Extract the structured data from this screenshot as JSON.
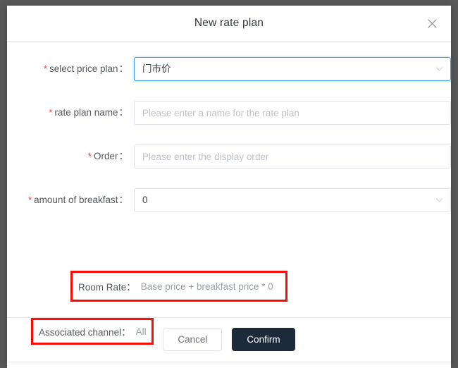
{
  "dialog": {
    "title": "New rate plan",
    "close_icon": "close-icon"
  },
  "form": {
    "fields": [
      {
        "label": "select price plan",
        "required": true,
        "type": "select",
        "value": "门市价",
        "focused": true,
        "chevron_icon": "chevron-down-icon"
      },
      {
        "label": "rate plan name",
        "required": true,
        "type": "text",
        "value": "",
        "placeholder": "Please enter a name for the rate plan"
      },
      {
        "label": "Order",
        "required": true,
        "type": "text",
        "value": "",
        "placeholder": "Please enter the display order"
      },
      {
        "label": "amount of breakfast",
        "required": true,
        "type": "select",
        "value": "0",
        "focused": false,
        "chevron_icon": "chevron-down-icon"
      }
    ],
    "colon": "：",
    "asterisk": "*"
  },
  "summary": {
    "room_rate": {
      "label": "Room Rate：",
      "value": "Base price + breakfast price * 0",
      "highlighted": true
    },
    "associated_channel": {
      "label": "Associated channel：",
      "value": "All",
      "highlighted": true
    }
  },
  "footer": {
    "cancel_label": "Cancel",
    "confirm_label": "Confirm"
  },
  "colors": {
    "highlight_box": "#fb0d06",
    "required_star": "#e8403a",
    "focus_border": "#3aa0f3",
    "confirm_button": "#1d2a3a",
    "overlay": "#585858"
  }
}
